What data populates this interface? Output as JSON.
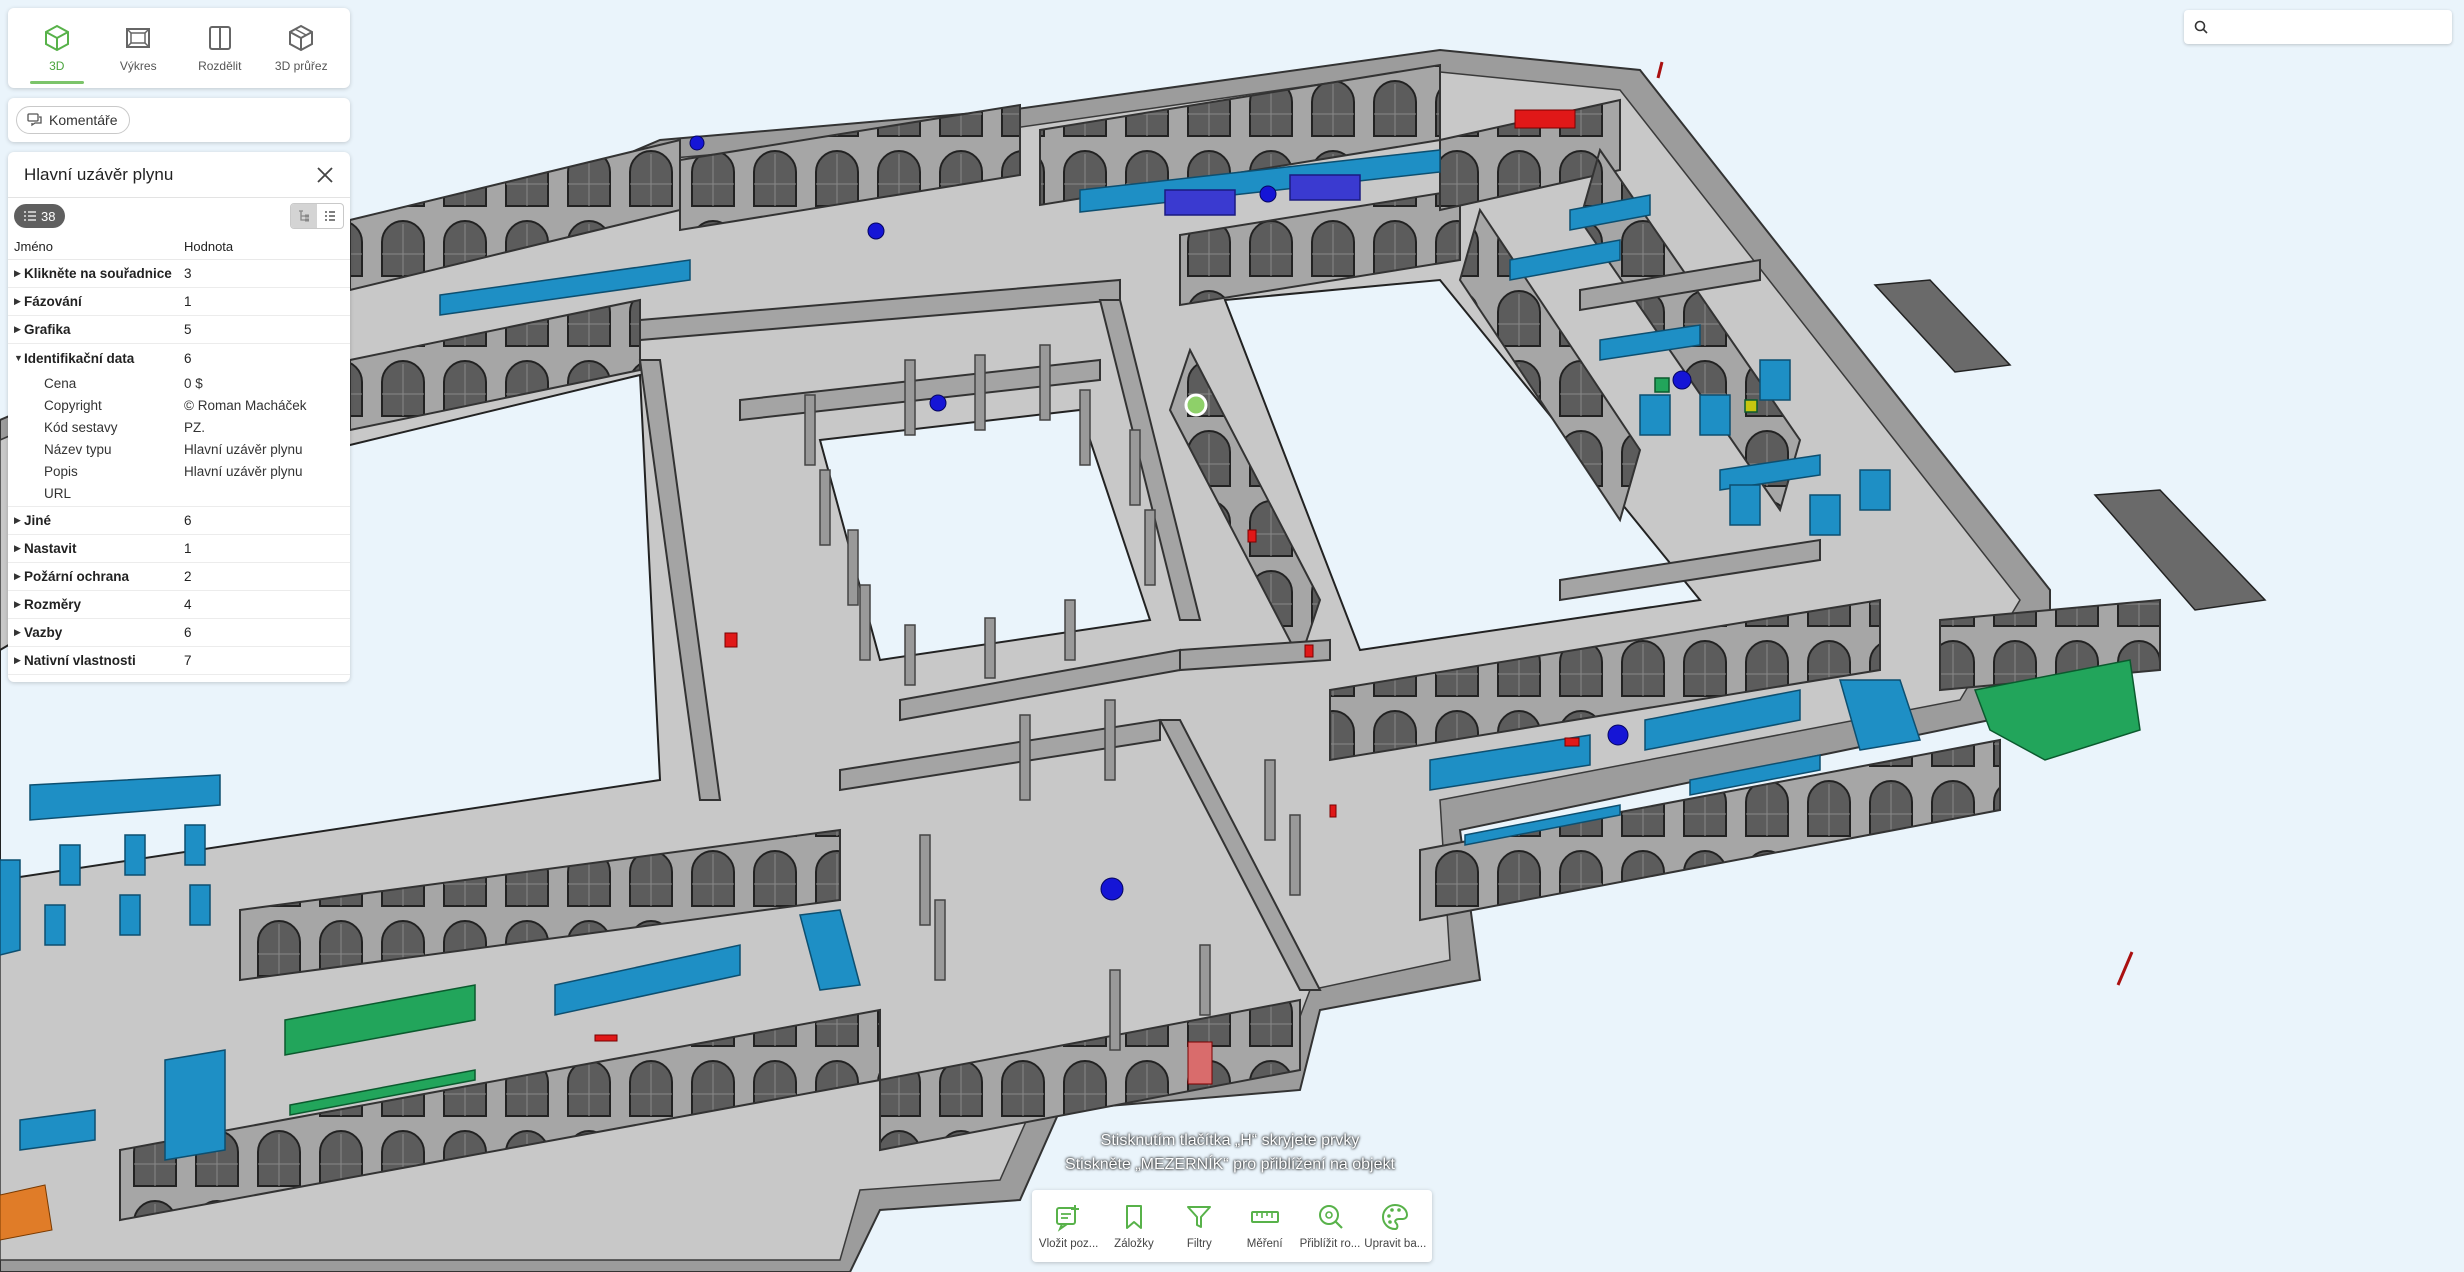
{
  "view_tabs": [
    {
      "label": "3D",
      "icon": "cube-icon",
      "active": true
    },
    {
      "label": "Výkres",
      "icon": "drawing-icon",
      "active": false
    },
    {
      "label": "Rozdělit",
      "icon": "split-icon",
      "active": false
    },
    {
      "label": "3D průřez",
      "icon": "section-cube-icon",
      "active": false
    }
  ],
  "comments": {
    "label": "Komentáře",
    "icon": "comment-icon"
  },
  "properties": {
    "title": "Hlavní uzávěr plynu",
    "count": "38",
    "columns": {
      "name": "Jméno",
      "value": "Hodnota"
    },
    "groups": [
      {
        "name": "Klikněte na souřadnice",
        "value": "3",
        "expanded": false
      },
      {
        "name": "Fázování",
        "value": "1",
        "expanded": false
      },
      {
        "name": "Grafika",
        "value": "5",
        "expanded": false
      },
      {
        "name": "Identifikační data",
        "value": "6",
        "expanded": true
      },
      {
        "name": "Jiné",
        "value": "6",
        "expanded": false
      },
      {
        "name": "Nastavit",
        "value": "1",
        "expanded": false
      },
      {
        "name": "Požární ochrana",
        "value": "2",
        "expanded": false
      },
      {
        "name": "Rozměry",
        "value": "4",
        "expanded": false
      },
      {
        "name": "Vazby",
        "value": "6",
        "expanded": false
      },
      {
        "name": "Nativní vlastnosti",
        "value": "7",
        "expanded": false
      }
    ],
    "identification_items": [
      {
        "name": "Cena",
        "value": "0 $"
      },
      {
        "name": "Copyright",
        "value": "© Roman Macháček"
      },
      {
        "name": "Kód sestavy",
        "value": "PZ."
      },
      {
        "name": "Název typu",
        "value": "Hlavní uzávěr plynu"
      },
      {
        "name": "Popis",
        "value": "Hlavní uzávěr plynu"
      },
      {
        "name": "URL",
        "value": ""
      }
    ]
  },
  "search": {
    "placeholder": "",
    "icon": "search-icon"
  },
  "hints": {
    "line1": "Stisknutím tlačítka „H“ skryjete prvky",
    "line2": "Stiskněte „MEZERNÍK“ pro přiblížení na objekt"
  },
  "toolbar": [
    {
      "label": "Vložit poz...",
      "icon": "add-comment-icon"
    },
    {
      "label": "Záložky",
      "icon": "bookmark-icon"
    },
    {
      "label": "Filtry",
      "icon": "filter-icon"
    },
    {
      "label": "Měření",
      "icon": "ruler-icon"
    },
    {
      "label": "Přiblížit ro...",
      "icon": "zoom-icon"
    },
    {
      "label": "Upravit ba...",
      "icon": "palette-icon"
    }
  ],
  "colors": {
    "accent": "#7cc46a",
    "background": "#eaf4fb",
    "wall": "#a9a9a9",
    "floor": "#bdbdbd",
    "furniture_blue": "#1f8fc4",
    "furniture_green": "#1fa45a",
    "marker_blue": "#1a1ad6",
    "marker_red": "#e01515"
  }
}
